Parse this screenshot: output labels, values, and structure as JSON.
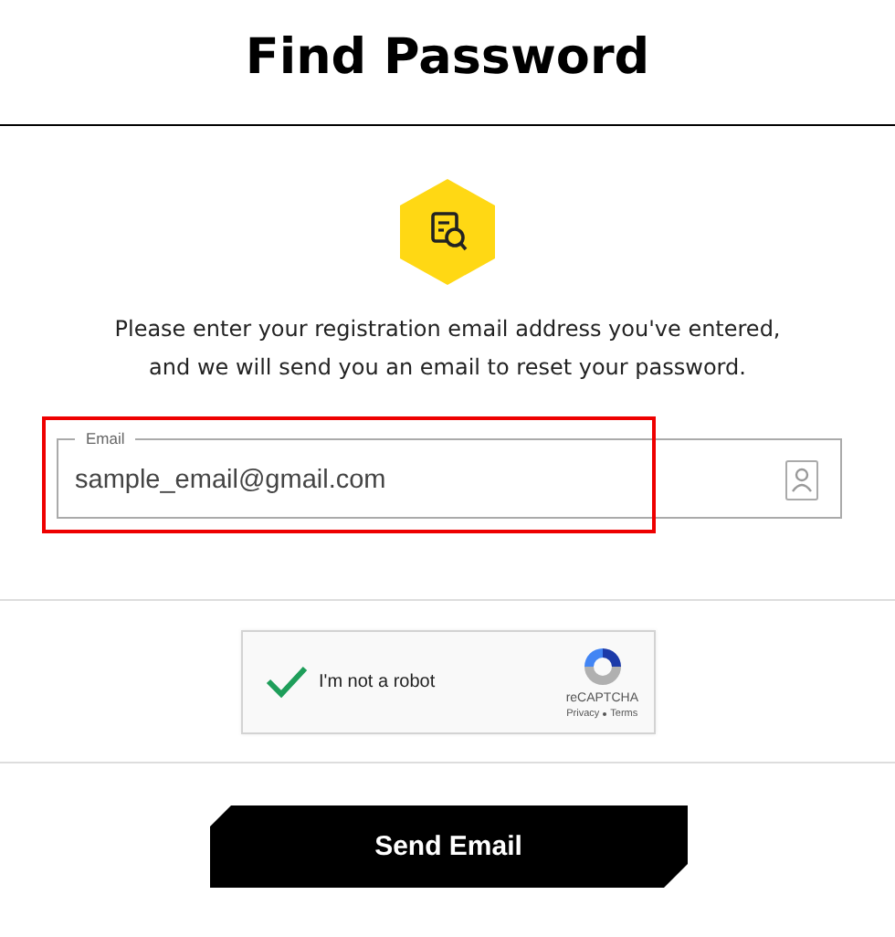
{
  "title": "Find Password",
  "description": "Please enter your registration email address you've entered, and we will send you an email to reset your password.",
  "email_field": {
    "label": "Email",
    "value": "sample_email@gmail.com",
    "highlighted": true
  },
  "captcha": {
    "label": "I'm not a robot",
    "checked": true,
    "brand": "reCAPTCHA",
    "links": [
      "Privacy",
      "Terms"
    ]
  },
  "button": "Send Email"
}
